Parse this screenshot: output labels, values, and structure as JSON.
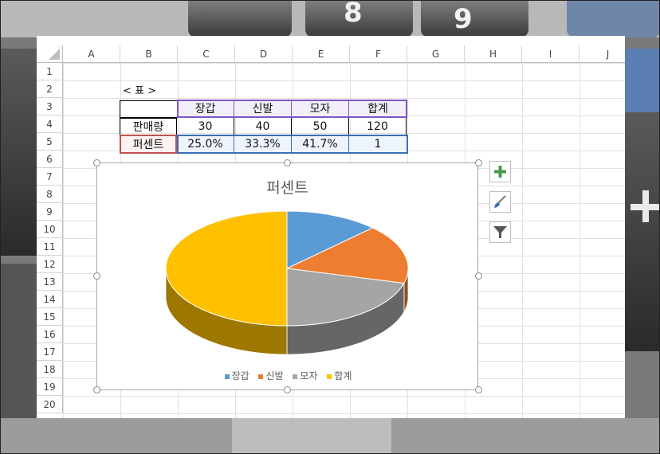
{
  "columns": [
    "A",
    "B",
    "C",
    "D",
    "E",
    "F",
    "G",
    "H",
    "I",
    "J"
  ],
  "rows": [
    "1",
    "2",
    "3",
    "4",
    "5",
    "6",
    "7",
    "8",
    "9",
    "10",
    "11",
    "12",
    "13",
    "14",
    "15",
    "16",
    "17",
    "18",
    "19",
    "20"
  ],
  "table": {
    "caption": "< 표 >",
    "headers": [
      "장갑",
      "신발",
      "모자",
      "합계"
    ],
    "row_sales": {
      "label": "판매량",
      "values": [
        "30",
        "40",
        "50",
        "120"
      ]
    },
    "row_percent": {
      "label": "퍼센트",
      "values": [
        "25.0%",
        "33.3%",
        "41.7%",
        "1"
      ]
    }
  },
  "chart_data": {
    "type": "pie",
    "title": "퍼센트",
    "categories": [
      "장갑",
      "신발",
      "모자",
      "합계"
    ],
    "values": [
      0.25,
      0.333,
      0.417,
      1
    ],
    "colors": [
      "#5b9bd5",
      "#ed7d31",
      "#a5a5a5",
      "#ffc000"
    ],
    "legend": "bottom",
    "style": "3d"
  },
  "chart_tools": [
    {
      "name": "chart-elements-icon",
      "color": "#4a9a52"
    },
    {
      "name": "chart-styles-icon",
      "color": "#3b6fb6"
    },
    {
      "name": "chart-filters-icon",
      "color": "#555555"
    }
  ]
}
